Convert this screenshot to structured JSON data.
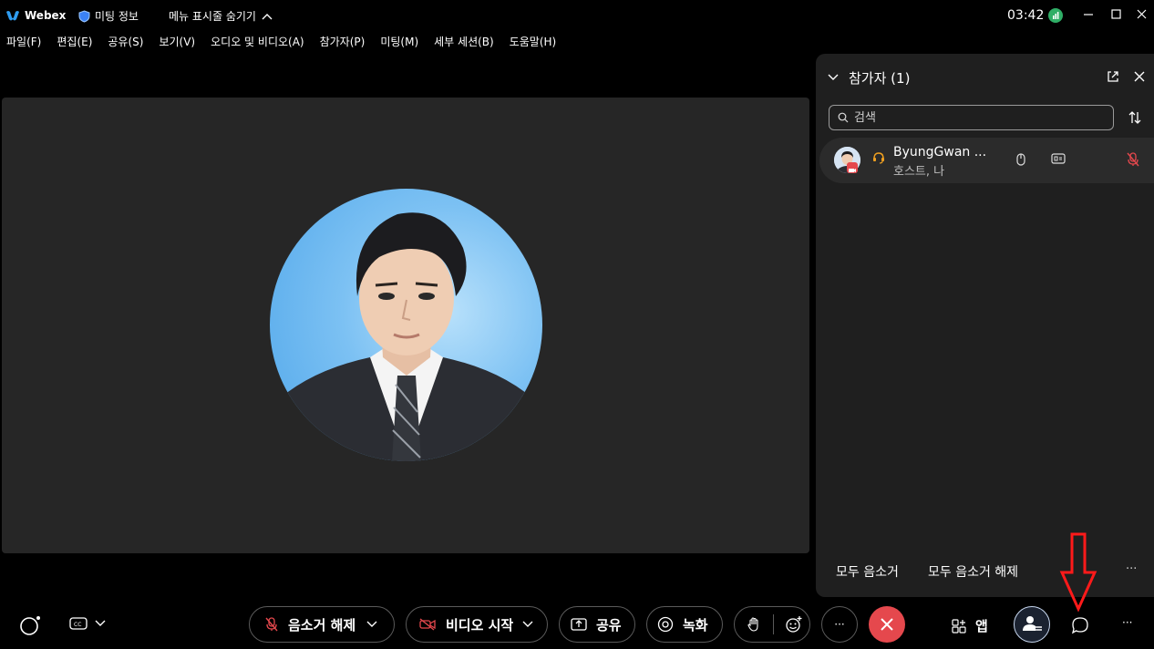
{
  "titlebar": {
    "app_name": "Webex",
    "meeting_info": "미팅 정보",
    "hide_menu": "메뉴 표시줄 숨기기",
    "clock": "03:42"
  },
  "menubar": {
    "items": [
      "파일(F)",
      "편집(E)",
      "공유(S)",
      "보기(V)",
      "오디오 및 비디오(A)",
      "참가자(P)",
      "미팅(M)",
      "세부 세션(B)",
      "도움말(H)"
    ]
  },
  "panel": {
    "title": "참가자 (1)",
    "search_placeholder": "검색",
    "participant": {
      "name": "ByungGwan ...",
      "role": "호스트, 나"
    },
    "mute_all": "모두 음소거",
    "unmute_all": "모두 음소거 해제",
    "more": "···"
  },
  "controls": {
    "unmute": "음소거 해제",
    "start_video": "비디오 시작",
    "share": "공유",
    "record": "녹화",
    "more": "···",
    "apps": "앱",
    "overflow": "···"
  },
  "colors": {
    "background": "#000000",
    "stage": "#262626",
    "panel": "#1f1f1f",
    "end_call": "#e5484d",
    "muted_red": "#e5484d",
    "host_icon": "#f0a020",
    "annotation": "#ff1a1a"
  }
}
